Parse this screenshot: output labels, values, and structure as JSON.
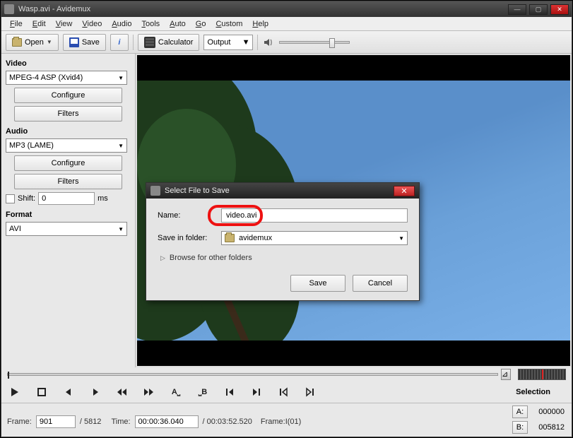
{
  "titlebar": {
    "title": "Wasp.avi - Avidemux"
  },
  "menu": [
    "File",
    "Edit",
    "View",
    "Video",
    "Audio",
    "Tools",
    "Auto",
    "Go",
    "Custom",
    "Help"
  ],
  "toolbar": {
    "open": "Open",
    "save": "Save",
    "calculator": "Calculator",
    "output": "Output"
  },
  "sidebar": {
    "video_label": "Video",
    "video_codec": "MPEG-4 ASP (Xvid4)",
    "configure": "Configure",
    "filters": "Filters",
    "audio_label": "Audio",
    "audio_codec": "MP3 (LAME)",
    "shift_label": "Shift:",
    "shift_value": "0",
    "shift_unit": "ms",
    "format_label": "Format",
    "format_value": "AVI"
  },
  "controls": {
    "selection_label": "Selection"
  },
  "status": {
    "frame_label": "Frame:",
    "frame_value": "901",
    "frame_total": "/ 5812",
    "time_label": "Time:",
    "time_value": "00:00:36.040",
    "time_total": "/ 00:03:52.520",
    "frame_type": "Frame:I(01)",
    "a_label": "A:",
    "a_value": "000000",
    "b_label": "B:",
    "b_value": "005812"
  },
  "dialog": {
    "title": "Select File to Save",
    "name_label": "Name:",
    "name_value": "video.avi",
    "folder_label": "Save in folder:",
    "folder_value": "avidemux",
    "browse": "Browse for other folders",
    "save": "Save",
    "cancel": "Cancel"
  }
}
